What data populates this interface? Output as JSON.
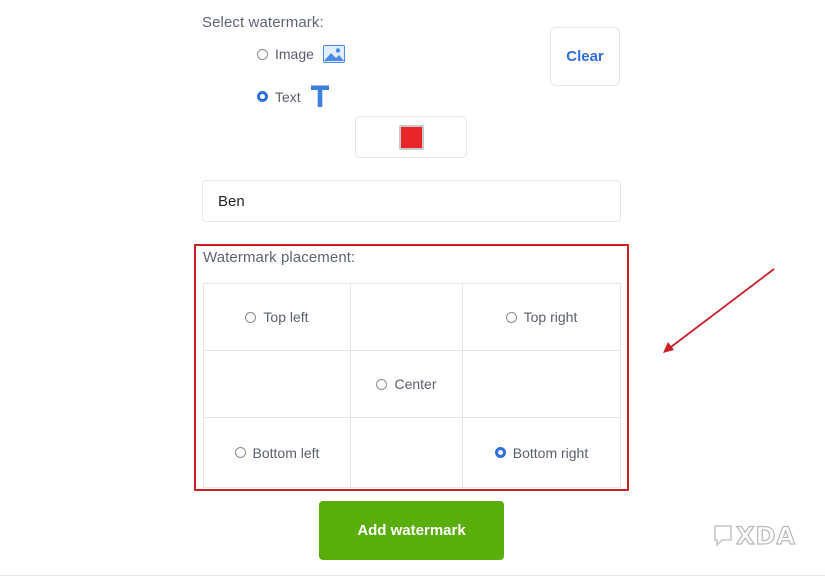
{
  "watermark_select": {
    "label": "Select watermark:",
    "options": [
      {
        "label": "Image",
        "selected": false,
        "icon": "image-icon"
      },
      {
        "label": "Text",
        "selected": true,
        "icon": "text-t-icon"
      }
    ],
    "clear_label": "Clear"
  },
  "color": {
    "value": "#e8262a"
  },
  "text_field": {
    "value": "Ben"
  },
  "placement": {
    "label": "Watermark placement:",
    "options": {
      "top_left": {
        "label": "Top left",
        "selected": false
      },
      "top_right": {
        "label": "Top right",
        "selected": false
      },
      "center": {
        "label": "Center",
        "selected": false
      },
      "bottom_left": {
        "label": "Bottom left",
        "selected": false
      },
      "bottom_right": {
        "label": "Bottom right",
        "selected": true
      }
    }
  },
  "add_button": {
    "label": "Add watermark"
  },
  "brand": {
    "logo_text": "XDA"
  },
  "colors": {
    "accent": "#2f6fe0",
    "primary_button": "#5aae0c",
    "highlight": "#cc2029"
  }
}
